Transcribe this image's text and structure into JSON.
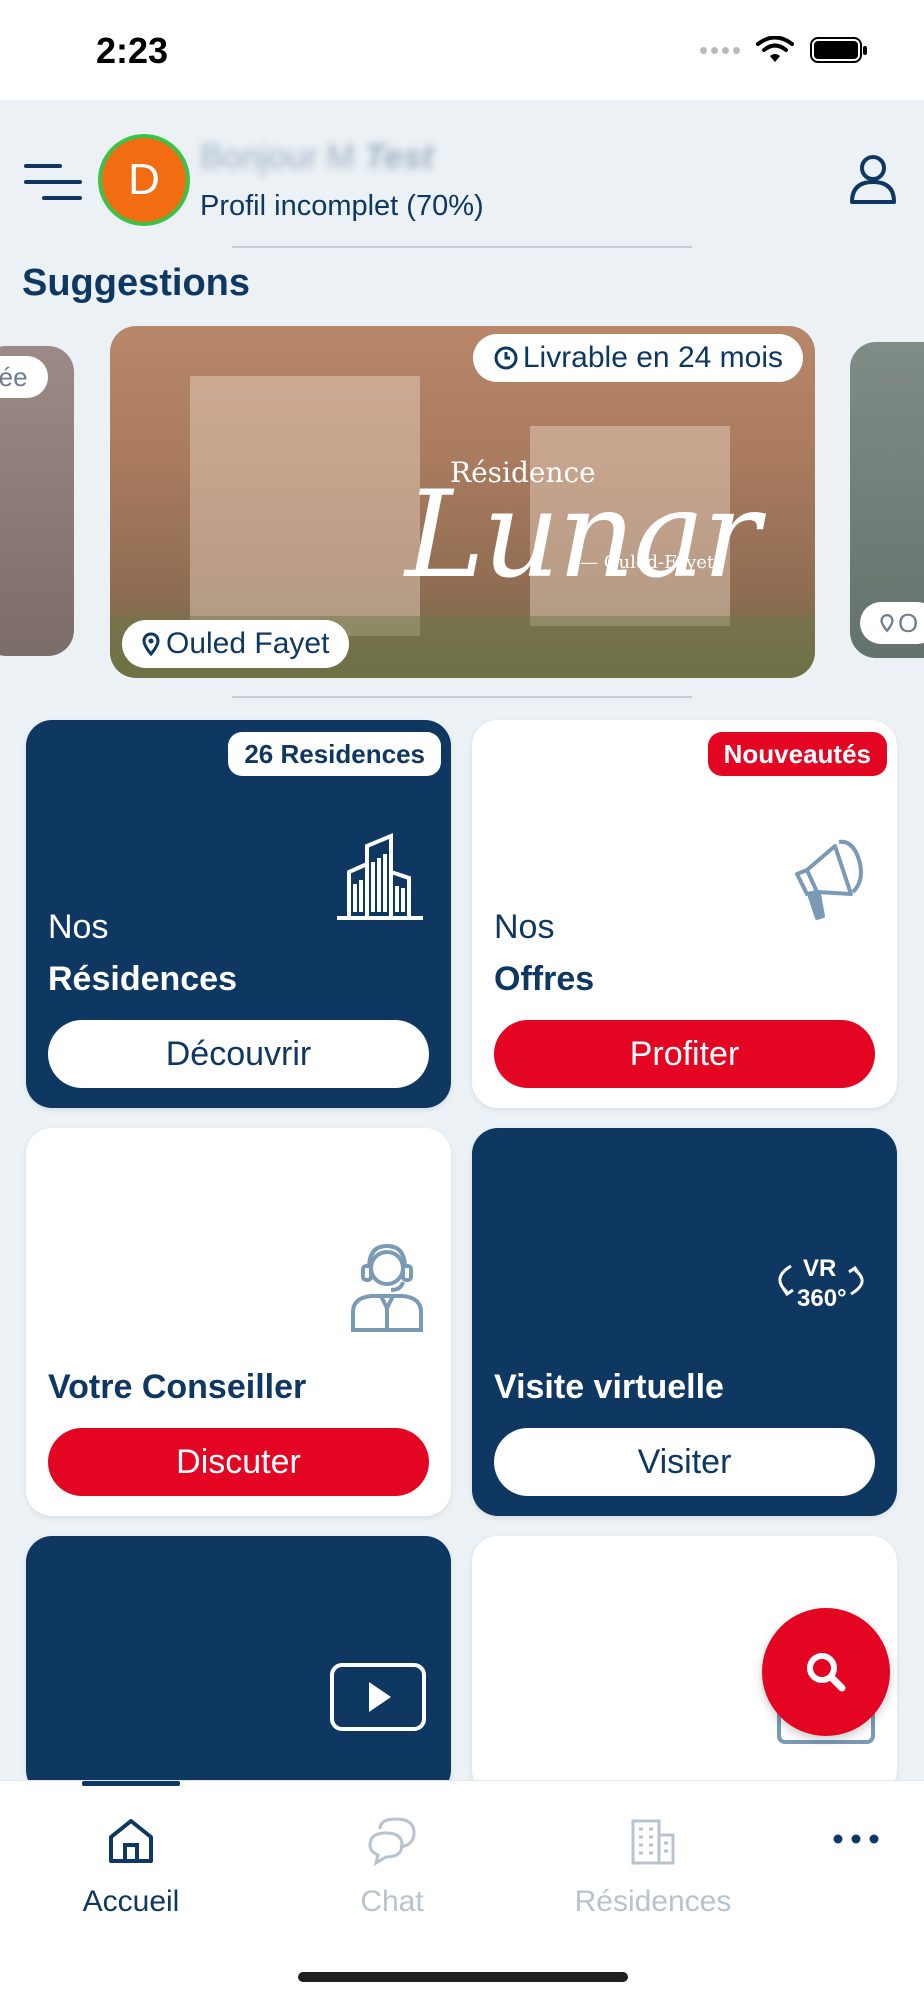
{
  "status_bar": {
    "time": "2:23"
  },
  "header": {
    "avatar_initial": "D",
    "greeting": "Bonjour M",
    "greeting_name": "Test",
    "profile_status": "Profil incomplet (70%)"
  },
  "suggestions": {
    "title": "Suggestions",
    "left_location": "rée",
    "main": {
      "delivery": "Livrable en 24 mois",
      "logo_top": "Résidence",
      "logo_name": "Lunar",
      "logo_sub": "— Ouled-Fayet",
      "location": "Ouled Fayet"
    },
    "right_location": "O"
  },
  "cards": {
    "residences": {
      "badge": "26 Residences",
      "line1": "Nos",
      "line2": "Résidences",
      "button": "Découvrir"
    },
    "offres": {
      "badge": "Nouveautés",
      "line1": "Nos",
      "line2": "Offres",
      "button": "Profiter"
    },
    "conseiller": {
      "title": "Votre Conseiller",
      "button": "Discuter"
    },
    "visite": {
      "title": "Visite virtuelle",
      "button": "Visiter",
      "icon_text_top": "VR",
      "icon_text_bottom": "360°"
    }
  },
  "tabbar": {
    "tabs": [
      {
        "label": "Accueil",
        "icon": "home-icon",
        "active": true
      },
      {
        "label": "Chat",
        "icon": "chat-icon",
        "active": false
      },
      {
        "label": "Résidences",
        "icon": "building-icon",
        "active": false
      },
      {
        "label": "",
        "icon": "more-icon",
        "active": false
      }
    ]
  },
  "colors": {
    "navy": "#0e3761",
    "red": "#e30521",
    "background": "#ebf1f5",
    "avatar": "#f26c12",
    "avatar_ring": "#3ac249"
  }
}
